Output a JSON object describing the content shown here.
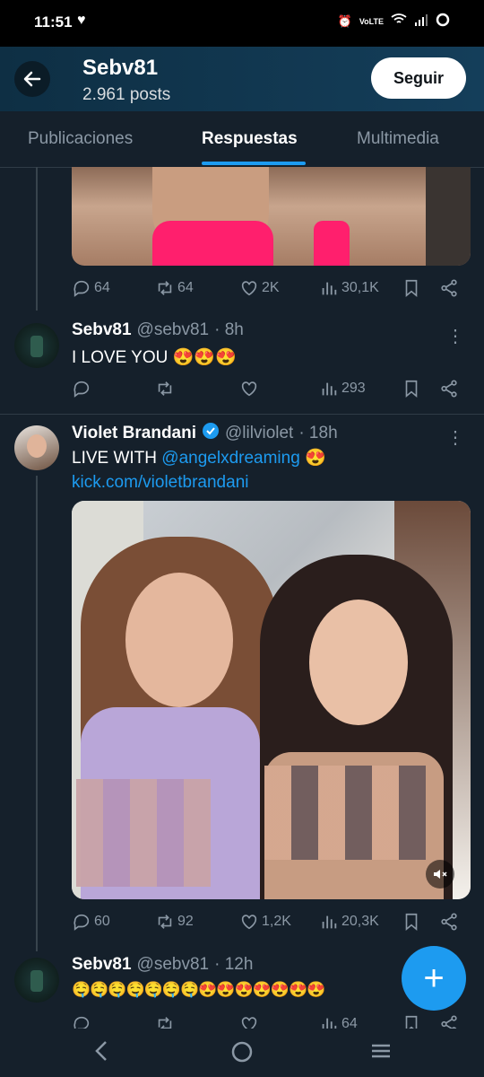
{
  "status": {
    "time": "11:51",
    "carrier": "VoLTE"
  },
  "header": {
    "title": "Sebv81",
    "subtitle": "2.961 posts",
    "follow_label": "Seguir"
  },
  "tabs": [
    {
      "label": "Publicaciones"
    },
    {
      "label": "Respuestas"
    },
    {
      "label": "Multimedia"
    }
  ],
  "tweet0": {
    "replies": "64",
    "retweets": "64",
    "likes": "2K",
    "views": "30,1K"
  },
  "tweet1": {
    "name": "Sebv81",
    "handle": "@sebv81",
    "time": "· 8h",
    "text": "I LOVE YOU 😍😍😍",
    "views": "293"
  },
  "tweet2": {
    "name": "Violet Brandani",
    "handle": "@lilviolet",
    "time": "· 18h",
    "text_prefix": "LIVE WITH ",
    "mention": "@angelxdreaming",
    "emoji": " 😍",
    "link": "kick.com/violetbrandani",
    "replies": "60",
    "retweets": "92",
    "likes": "1,2K",
    "views": "20,3K"
  },
  "tweet3": {
    "name": "Sebv81",
    "handle": "@sebv81",
    "time": "· 12h",
    "text": "🤤🤤🤤🤤🤤🤤🤤😍😍😍😍😍😍😍",
    "views": "64"
  },
  "colors": {
    "accent": "#1d9bf0",
    "background": "#15202b",
    "muted": "#8b98a5"
  }
}
